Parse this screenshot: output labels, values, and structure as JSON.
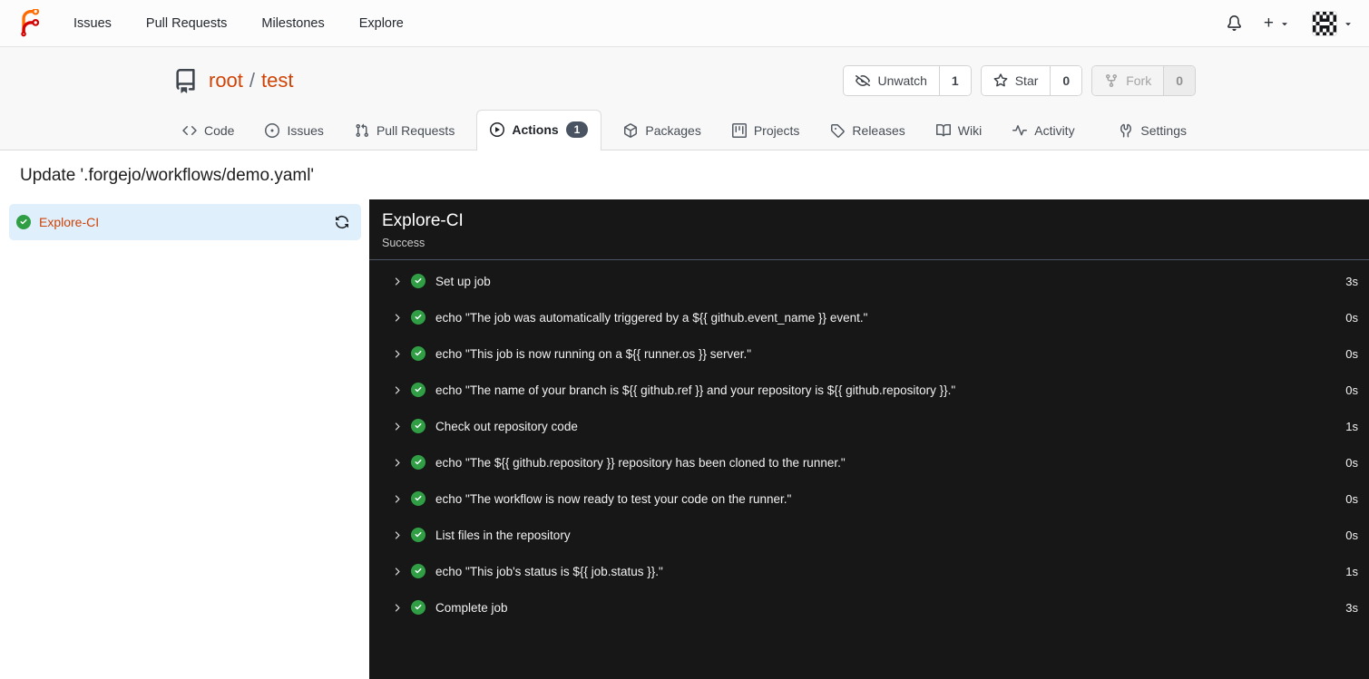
{
  "navbar": {
    "items": [
      {
        "label": "Issues"
      },
      {
        "label": "Pull Requests"
      },
      {
        "label": "Milestones"
      },
      {
        "label": "Explore"
      }
    ],
    "create_label": "+"
  },
  "repo": {
    "owner": "root",
    "separator": "/",
    "name": "test",
    "buttons": {
      "unwatch": {
        "label": "Unwatch",
        "count": "1"
      },
      "star": {
        "label": "Star",
        "count": "0"
      },
      "fork": {
        "label": "Fork",
        "count": "0"
      }
    }
  },
  "tabs": {
    "code": "Code",
    "issues": "Issues",
    "pulls": "Pull Requests",
    "actions": "Actions",
    "actions_badge": "1",
    "packages": "Packages",
    "projects": "Projects",
    "releases": "Releases",
    "wiki": "Wiki",
    "activity": "Activity",
    "settings": "Settings"
  },
  "page": {
    "title": "Update '.forgejo/workflows/demo.yaml'"
  },
  "sidebar": {
    "job_name": "Explore-CI"
  },
  "panel": {
    "title": "Explore-CI",
    "status": "Success",
    "steps": [
      {
        "name": "Set up job",
        "duration": "3s"
      },
      {
        "name": "echo \"The job was automatically triggered by a ${{ github.event_name }} event.\"",
        "duration": "0s"
      },
      {
        "name": "echo \"This job is now running on a ${{ runner.os }} server.\"",
        "duration": "0s"
      },
      {
        "name": "echo \"The name of your branch is ${{ github.ref }} and your repository is ${{ github.repository }}.\"",
        "duration": "0s"
      },
      {
        "name": "Check out repository code",
        "duration": "1s"
      },
      {
        "name": "echo \"The ${{ github.repository }} repository has been cloned to the runner.\"",
        "duration": "0s"
      },
      {
        "name": "echo \"The workflow is now ready to test your code on the runner.\"",
        "duration": "0s"
      },
      {
        "name": "List files in the repository",
        "duration": "0s"
      },
      {
        "name": "echo \"This job's status is ${{ job.status }}.\"",
        "duration": "1s"
      },
      {
        "name": "Complete job",
        "duration": "3s"
      }
    ]
  },
  "colors": {
    "primary_link": "#cf4307",
    "success_green": "#2f9e44",
    "panel_bg": "#171717",
    "selected_item_bg": "#dfeffb",
    "badge_bg": "#495362"
  }
}
